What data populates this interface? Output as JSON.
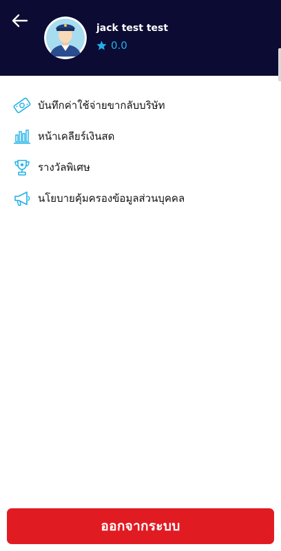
{
  "header": {
    "user_name": "jack test test",
    "rating": "0.0",
    "back_icon": "back-arrow-icon",
    "rating_icon": "star-icon"
  },
  "menu": {
    "items": [
      {
        "label": "บันทึกค่าใช้จ่ายขากลับบริษัท",
        "icon": "money-bill-icon"
      },
      {
        "label": "หน้าเคลียร์เงินสด",
        "icon": "bar-chart-icon"
      },
      {
        "label": "รางวัลพิเศษ",
        "icon": "trophy-icon"
      },
      {
        "label": "นโยบายคุ้มครองข้อมูลส่วนบุคคล",
        "icon": "megaphone-icon"
      }
    ]
  },
  "footer": {
    "logout_label": "ออกจากระบบ"
  },
  "colors": {
    "header_bg": "#0c0b33",
    "accent": "#1fb0e6",
    "logout_bg": "#e11b22"
  }
}
